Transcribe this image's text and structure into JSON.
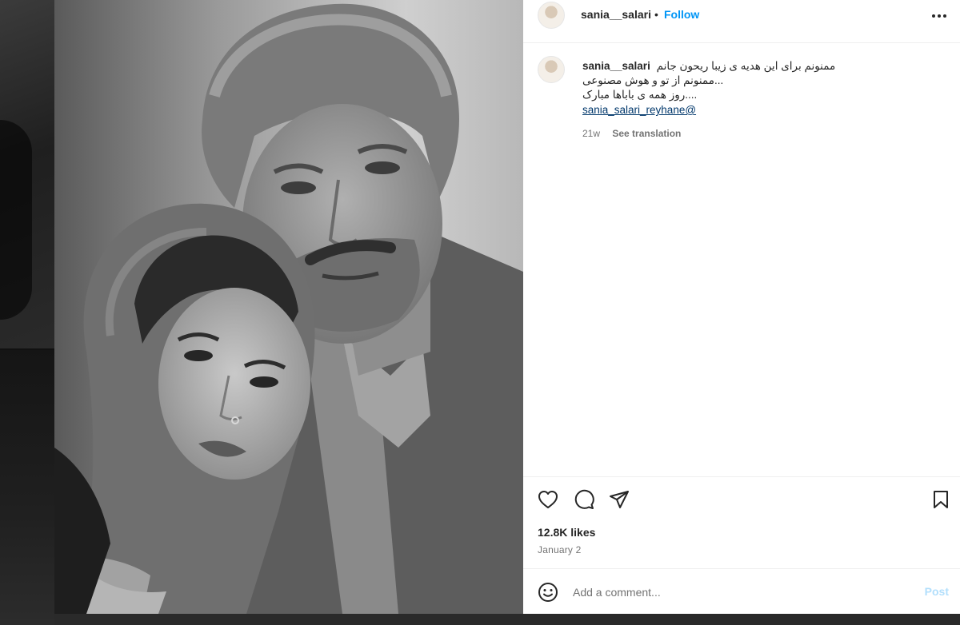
{
  "post": {
    "username": "sania__salari",
    "separator": "•",
    "follow_label": "Follow",
    "more_icon": "more-horizontal-icon"
  },
  "caption": {
    "username": "sania__salari",
    "lines": [
      "ممنونم برای این هدیه ی زیبا ریحون جانم",
      "ممنونم از تو و هوش مصنوعی...",
      "روز همه ی باباها مبارک...."
    ],
    "mention": "sania_salari_reyhane@",
    "time_ago": "21w",
    "see_translation": "See translation"
  },
  "actions": {
    "like_icon": "heart-icon",
    "comment_icon": "comment-icon",
    "share_icon": "share-icon",
    "save_icon": "bookmark-icon"
  },
  "likes": "12.8K likes",
  "date": "January 2",
  "comment": {
    "placeholder": "Add a comment...",
    "post_label": "Post",
    "emoji_icon": "emoji-icon"
  },
  "colors": {
    "link_blue": "#0095f6",
    "post_disabled": "#b2dffc",
    "mention": "#00376b",
    "meta_gray": "#737373"
  }
}
